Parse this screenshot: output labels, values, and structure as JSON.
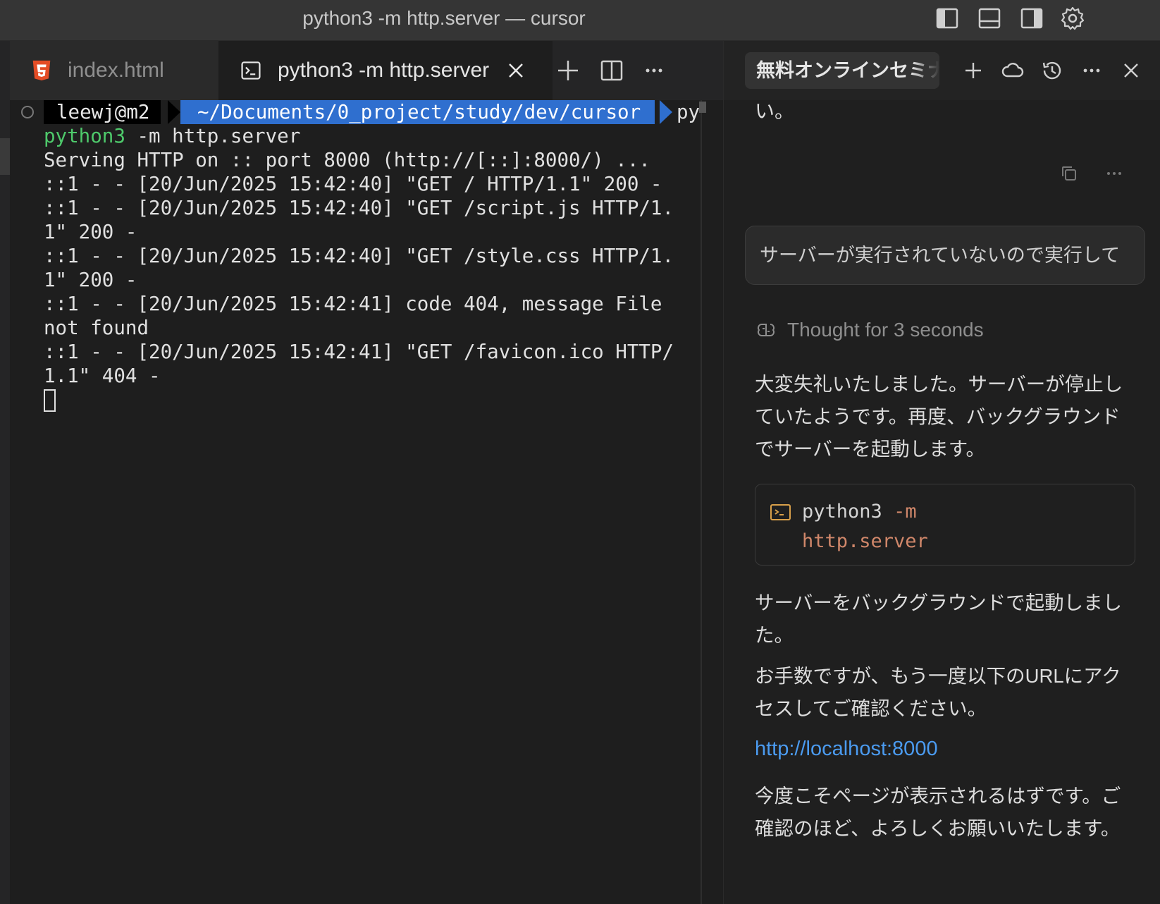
{
  "window": {
    "title": "python3 -m http.server — cursor",
    "icons": [
      "sidebar-left-icon",
      "panel-bottom-icon",
      "sidebar-right-icon",
      "gear-icon"
    ]
  },
  "editor_tabs": [
    {
      "label": "index.html",
      "icon": "html5-icon",
      "active": false
    },
    {
      "label": "python3 -m http.server",
      "icon": "terminal-icon",
      "active": true
    }
  ],
  "tab_actions": [
    "plus-icon",
    "split-editor-icon",
    "more-icon"
  ],
  "terminal": {
    "prompt_user": "leewj@m2",
    "prompt_path": "~/Documents/0_project/study/dev/cursor",
    "prompt_tail": "py",
    "command_name": "python3",
    "command_args": " -m http.server",
    "lines": [
      "Serving HTTP on :: port 8000 (http://[::]:8000/) ...",
      "::1 - - [20/Jun/2025 15:42:40] \"GET / HTTP/1.1\" 200 -",
      "::1 - - [20/Jun/2025 15:42:40] \"GET /script.js HTTP/1.",
      "1\" 200 -",
      "::1 - - [20/Jun/2025 15:42:40] \"GET /style.css HTTP/1.",
      "1\" 200 -",
      "::1 - - [20/Jun/2025 15:42:41] code 404, message File",
      "not found",
      "::1 - - [20/Jun/2025 15:42:41] \"GET /favicon.ico HTTP/",
      "1.1\" 404 -"
    ]
  },
  "chat": {
    "tab_title": "無料オンラインセミナ",
    "header_actions": [
      "plus-icon",
      "cloud-icon",
      "history-icon",
      "more-icon",
      "close-icon"
    ],
    "partial_top_text": "い。",
    "user_message": "サーバーが実行されていないので実行して",
    "thought_label": "Thought for 3 seconds",
    "para1": "大変失礼いたしました。サーバーが停止していたようです。再度、バックグラウンドでサーバーを起動します。",
    "code_line1": "python3 -m",
    "code_line1_cmd": "python3",
    "code_line1_flag": "-m",
    "code_line2": "http.server",
    "para2": "サーバーをバックグラウンドで起動しました。",
    "para3": "お手数ですが、もう一度以下のURLにアクセスしてご確認ください。",
    "link": "http://localhost:8000",
    "para4": "今度こそページが表示されるはずです。ご確認のほど、よろしくお願いいたします。"
  }
}
